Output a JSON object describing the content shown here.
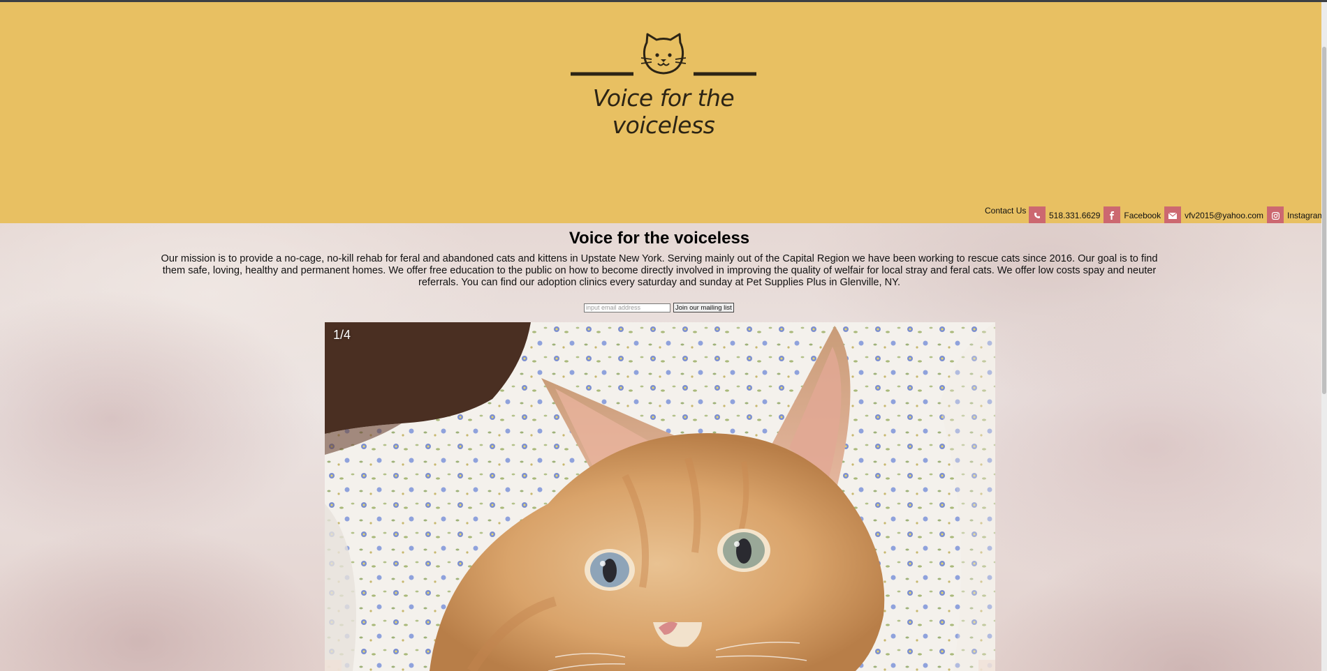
{
  "header": {
    "logo_text": "Voice for the voiceless",
    "background_color": "#e8c062"
  },
  "contact": {
    "label": "Contact Us",
    "phone": {
      "icon": "phone-icon",
      "text": "518.331.6629"
    },
    "facebook": {
      "icon": "facebook-icon",
      "text": "Facebook"
    },
    "email": {
      "icon": "mail-icon",
      "text": "vfv2015@yahoo.com"
    },
    "instagram": {
      "icon": "instagram-icon",
      "text": "Instagram"
    },
    "icon_color": "#cc6870"
  },
  "main": {
    "title": "Voice for the voiceless",
    "mission": "Our mission is to provide a no-cage, no-kill rehab for feral and abandoned cats and kittens in Upstate New York. Serving mainly out of the Capital Region we have been working to rescue cats since 2016. Our goal is to find them safe, loving, healthy and permanent homes. We offer free education to the public on how to become directly involved in improving the quality of welfair for local stray and feral cats. We offer low costs spay and neuter referrals. You can find our adoption clinics every saturday and sunday at Pet Supplies Plus in Glenville, NY."
  },
  "mailing_list": {
    "placeholder": "input email address",
    "button_label": "Join our mailing list"
  },
  "slideshow": {
    "counter": "1/4"
  }
}
